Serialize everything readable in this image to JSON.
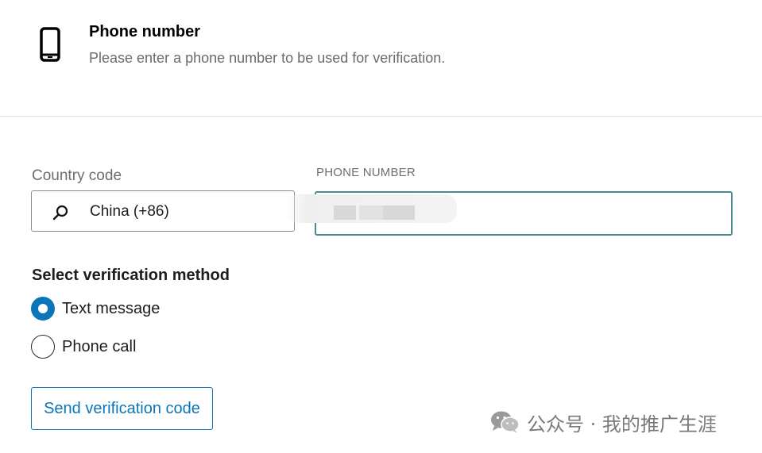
{
  "header": {
    "title": "Phone number",
    "subtitle": "Please enter a phone number to be used for verification.",
    "icon": "mobile-phone-icon"
  },
  "country_code": {
    "label": "Country code",
    "value": "China (+86)",
    "icon": "search-icon"
  },
  "phone_number": {
    "label": "PHONE NUMBER",
    "value": ""
  },
  "verification": {
    "title": "Select verification method",
    "options": [
      {
        "label": "Text message",
        "selected": true
      },
      {
        "label": "Phone call",
        "selected": false
      }
    ]
  },
  "send_button": {
    "label": "Send verification code"
  },
  "watermark": {
    "text": "公众号 · 我的推广生涯",
    "icon": "wechat-icon"
  },
  "colors": {
    "accent": "#0a75ba",
    "focus_border": "#4b8a93",
    "muted_text": "#6e6e6e"
  }
}
